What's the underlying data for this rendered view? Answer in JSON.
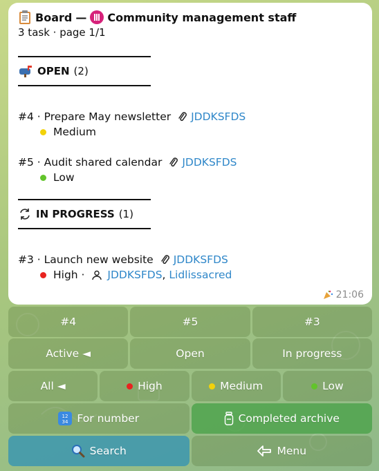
{
  "message": {
    "board_label": "Board",
    "dash": "—",
    "community_name": "Community management staff",
    "subtitle": "3 task · page 1/1",
    "sections": [
      {
        "title": "OPEN",
        "count": "(2)",
        "tasks": [
          {
            "id": "#4",
            "name": "Prepare May newsletter",
            "assignee": "JDDKSFDS",
            "priority": "Medium",
            "priority_color": "#f2d20a"
          },
          {
            "id": "#5",
            "name": "Audit shared calendar",
            "assignee": "JDDKSFDS",
            "priority": "Low",
            "priority_color": "#62c42b"
          }
        ]
      },
      {
        "title": "IN PROGRESS",
        "count": "(1)",
        "tasks": [
          {
            "id": "#3",
            "name": "Launch new website",
            "assignee": "JDDKSFDS",
            "priority": "High",
            "priority_color": "#e8231f",
            "members": [
              "JDDKSFDS",
              "Lidlissacred"
            ]
          }
        ]
      }
    ],
    "time": "21:06"
  },
  "keyboard": {
    "row1": [
      "#4",
      "#5",
      "#3"
    ],
    "row2": [
      "Active ◄",
      "Open",
      "In progress"
    ],
    "row3": [
      {
        "label": "All ◄"
      },
      {
        "label": "High",
        "dot": "#e8231f"
      },
      {
        "label": "Medium",
        "dot": "#f2d20a"
      },
      {
        "label": "Low",
        "dot": "#62c42b"
      }
    ],
    "row4": [
      "For number",
      "Completed archive"
    ],
    "row5": [
      "Search",
      "Menu"
    ]
  },
  "colors": {
    "link": "#2f87c9",
    "community_badge": "#d6227a"
  },
  "icons": {
    "board": "clipboard-icon",
    "community": "community-logo-icon",
    "open_section": "mailbox-icon",
    "progress_section": "refresh-icon",
    "attachment": "paperclip-icon",
    "members": "person-icon",
    "time": "party-popper-icon",
    "for_number": "numbers-1234-icon",
    "archive": "jar-icon",
    "search": "magnifier-icon",
    "menu": "back-arrow-icon"
  }
}
